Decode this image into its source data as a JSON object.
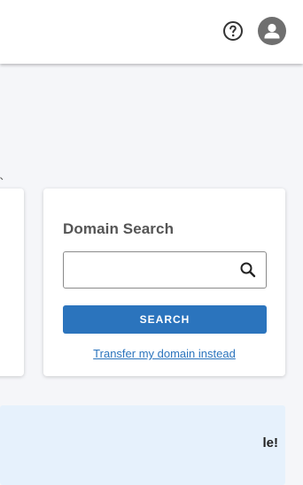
{
  "header": {
    "help_icon": "question-circle-icon",
    "avatar_icon": "person-icon"
  },
  "domain_search": {
    "title": "Domain Search",
    "input_value": "",
    "search_icon": "magnifier-icon",
    "button_label": "SEARCH",
    "transfer_link": "Transfer my domain instead"
  },
  "promo": {
    "text": "le!"
  },
  "colors": {
    "page_background": "#f5f6f9",
    "accent": "#2b74bd",
    "banner_background": "#e6f1fc",
    "avatar": "#6f6f6f"
  }
}
